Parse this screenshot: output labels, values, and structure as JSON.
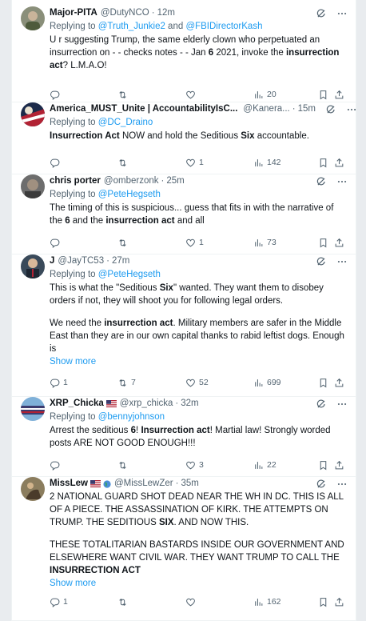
{
  "tweets": [
    {
      "name": "Major-PITA",
      "handle": "@DutyNCO",
      "time": "12m",
      "replying_prefix": "Replying to ",
      "replying_to": [
        "@Truth_Junkie2",
        "@FBIDirectorKash"
      ],
      "replying_joiner": " and ",
      "paragraphs": [
        [
          [
            "U r suggesting Trump, the same elderly clown who perpetuated an insurrection on - - checks notes - - Jan ",
            false
          ],
          [
            "6",
            true
          ],
          [
            " 2021, invoke the ",
            false
          ],
          [
            "insurrection act",
            true
          ],
          [
            "? L.M.A.O!",
            false
          ]
        ]
      ],
      "counts": {
        "replies": "",
        "reposts": "",
        "likes": "",
        "views": "20"
      }
    },
    {
      "name": "America_MUST_Unite | AccountabilityIsC...",
      "verified": true,
      "handle": "@Kanera...",
      "time": "15m",
      "replying_prefix": "Replying to ",
      "replying_to": [
        "@DC_Draino"
      ],
      "paragraphs": [
        [
          [
            "Insurrection Act",
            true
          ],
          [
            " NOW and hold the Seditious ",
            false
          ],
          [
            "Six",
            true
          ],
          [
            " accountable.",
            false
          ]
        ]
      ],
      "counts": {
        "replies": "",
        "reposts": "",
        "likes": "1",
        "views": "142"
      }
    },
    {
      "name": "chris porter",
      "handle": "@omberzonk",
      "time": "25m",
      "replying_prefix": "Replying to ",
      "replying_to": [
        "@PeteHegseth"
      ],
      "paragraphs": [
        [
          [
            "The timing of this is suspicious... guess that fits in with the narrative of the ",
            false
          ],
          [
            "6",
            true
          ],
          [
            " and the ",
            false
          ],
          [
            "insurrection act",
            true
          ],
          [
            " and all",
            false
          ]
        ]
      ],
      "counts": {
        "replies": "",
        "reposts": "",
        "likes": "1",
        "views": "73"
      }
    },
    {
      "name": "J",
      "handle": "@JayTC53",
      "time": "27m",
      "replying_prefix": "Replying to ",
      "replying_to": [
        "@PeteHegseth"
      ],
      "paragraphs": [
        [
          [
            "This is what the \"Seditious ",
            false
          ],
          [
            "Six",
            true
          ],
          [
            "\" wanted. They want them to disobey orders if not, they will shoot you for following legal orders.",
            false
          ]
        ],
        [
          [
            "We need the ",
            false
          ],
          [
            "insurrection act",
            true
          ],
          [
            ". Military members are safer in the Middle East than they are in our own capital thanks to rabid leftist dogs. Enough is",
            false
          ]
        ]
      ],
      "show_more": "Show more",
      "counts": {
        "replies": "1",
        "reposts": "7",
        "likes": "52",
        "views": "699"
      }
    },
    {
      "name": "XRP_Chicka",
      "flag_after_name": true,
      "handle": "@xrp_chicka",
      "time": "32m",
      "replying_prefix": "Replying to ",
      "replying_to": [
        "@bennyjohnson"
      ],
      "paragraphs": [
        [
          [
            "Arrest the seditious ",
            false
          ],
          [
            "6",
            true
          ],
          [
            "! ",
            false
          ],
          [
            "Insurrection act",
            true
          ],
          [
            "! Martial law! Strongly worded posts ARE NOT GOOD ENOUGH!!!",
            false
          ]
        ]
      ],
      "counts": {
        "replies": "",
        "reposts": "",
        "likes": "3",
        "views": "22"
      }
    },
    {
      "name": "MissLew",
      "flag_after_name": true,
      "globe_after_name": true,
      "handle": "@MissLewZer",
      "time": "35m",
      "replying_prefix": "",
      "replying_to": [],
      "paragraphs": [
        [
          [
            "2 NATIONAL GUARD SHOT DEAD NEAR THE WH IN DC. THIS IS ALL OF A PIECE. THE ASSASSINATION OF KIRK. THE ATTEMPTS ON TRUMP. THE SEDITIOUS ",
            false
          ],
          [
            "SIX",
            true
          ],
          [
            ". AND NOW THIS.",
            false
          ]
        ],
        [
          [
            "THESE TOTALITARIAN BASTARDS INSIDE OUR GOVERNMENT AND ELSEWHERE WANT CIVIL WAR. THEY WANT TRUMP TO CALL THE ",
            false
          ],
          [
            "INSURRECTION ACT",
            true
          ]
        ]
      ],
      "show_more": "Show more",
      "counts": {
        "replies": "1",
        "reposts": "",
        "likes": "",
        "views": "162"
      }
    }
  ],
  "colors": {
    "link": "#1d9bf0",
    "muted": "#536471",
    "text": "#0f1419",
    "verified": "#1d9bf0"
  },
  "icons": [
    "grok-icon",
    "more-icon",
    "reply-icon",
    "retweet-icon",
    "like-icon",
    "views-icon",
    "bookmark-icon",
    "share-icon"
  ]
}
